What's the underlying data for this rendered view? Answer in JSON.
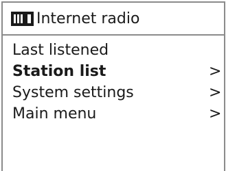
{
  "header": {
    "icon": "internet-radio-icon",
    "title": "Internet radio"
  },
  "menu": {
    "items": [
      {
        "label": "Last listened",
        "selected": false,
        "has_submenu": false,
        "chevron": ""
      },
      {
        "label": "Station list",
        "selected": true,
        "has_submenu": true,
        "chevron": ">"
      },
      {
        "label": "System settings",
        "selected": false,
        "has_submenu": true,
        "chevron": ">"
      },
      {
        "label": "Main menu",
        "selected": false,
        "has_submenu": true,
        "chevron": ">"
      }
    ]
  },
  "colors": {
    "text": "#1a1a1a",
    "border": "#8a8a8a",
    "background": "#ffffff"
  }
}
